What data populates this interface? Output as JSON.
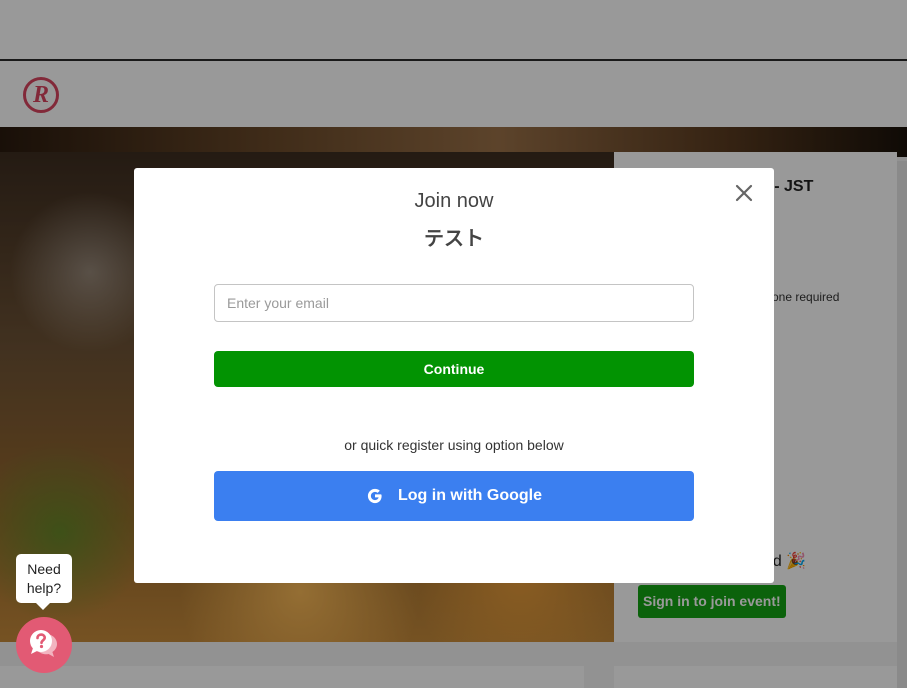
{
  "app": {
    "logo_letter": "R",
    "event_card": {
      "title_fragment": "n - JST",
      "note_fragment": "one required",
      "registration_fragment": "ed 🎉",
      "signin_label": "Sign in to join event!"
    }
  },
  "modal": {
    "title": "Join now",
    "subtitle": "テスト",
    "email_placeholder": "Enter your email",
    "continue_label": "Continue",
    "or_text": "or quick register using option below",
    "google_label": "Log in with Google"
  },
  "help": {
    "line1": "Need",
    "line2": "help?"
  },
  "colors": {
    "continue": "#029302",
    "google": "#3b7ff0",
    "brand": "#d9455f",
    "help_launcher": "#e25a74"
  }
}
